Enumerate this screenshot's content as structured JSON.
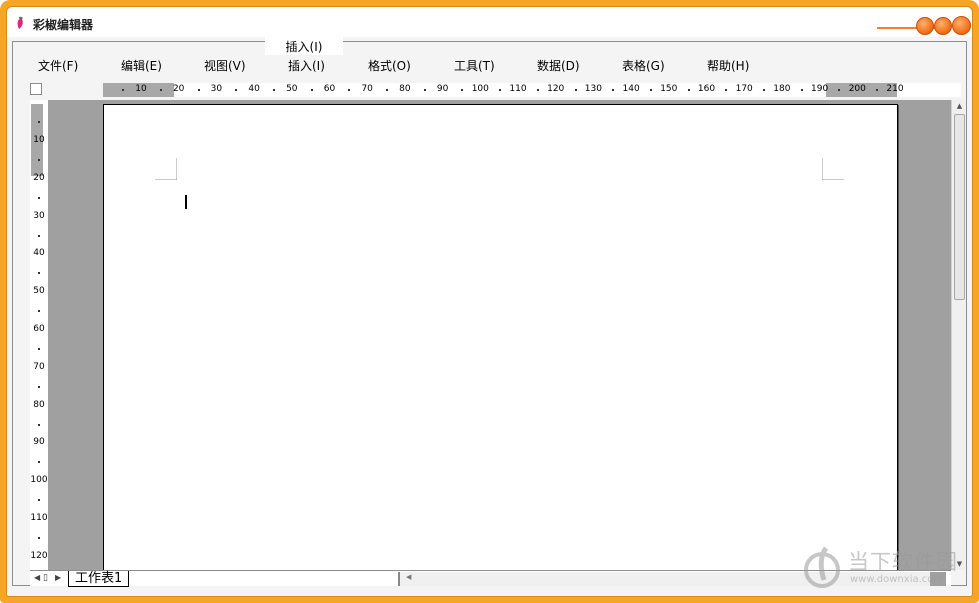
{
  "window": {
    "title": "彩椒编辑器",
    "active_tab_badge": "插入(I)",
    "accent_color": "#f6a623",
    "button_color": "#f06a10"
  },
  "menubar": {
    "items": [
      {
        "label": "文件(F)"
      },
      {
        "label": "编辑(E)"
      },
      {
        "label": "视图(V)"
      },
      {
        "label": "插入(I)"
      },
      {
        "label": "格式(O)"
      },
      {
        "label": "工具(T)"
      },
      {
        "label": "数据(D)"
      },
      {
        "label": "表格(G)"
      },
      {
        "label": "帮助(H)"
      }
    ]
  },
  "ruler": {
    "horizontal_ticks": [
      "10",
      "20",
      "30",
      "40",
      "50",
      "60",
      "70",
      "80",
      "90",
      "100",
      "110",
      "120",
      "130",
      "140",
      "150",
      "160",
      "170",
      "180",
      "190",
      "200",
      "210"
    ],
    "vertical_ticks": [
      "10",
      "20",
      "30",
      "40",
      "50",
      "60",
      "70",
      "80",
      "90",
      "100",
      "110",
      "120"
    ]
  },
  "sheets": {
    "tabs": [
      {
        "label": "工作表1"
      }
    ]
  },
  "watermark": {
    "brand": "当下软件园",
    "site": "www.downxia.com"
  }
}
